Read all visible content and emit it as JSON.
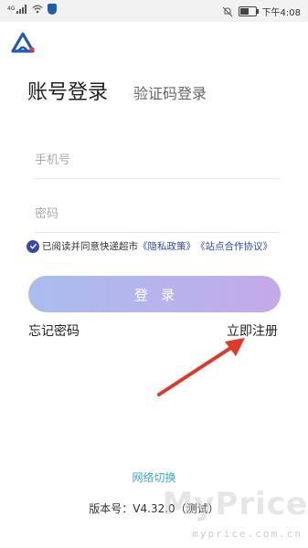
{
  "status_bar": {
    "signal_tag": "4G",
    "time": "下午4:08"
  },
  "login": {
    "tab_account": "账号登录",
    "tab_code": "验证码登录",
    "phone_placeholder": "手机号",
    "password_placeholder": "密码",
    "agree_prefix": "已阅读并同意快递超市",
    "privacy_link": "《隐私政策》",
    "partner_link": "《站点合作协议》",
    "login_button": "登录",
    "forgot_password": "忘记密码",
    "register": "立即注册",
    "network_switch": "网络切换",
    "version": "版本号：V4.32.0（测试）"
  },
  "watermark": {
    "brand": "MyPrice",
    "url": "myprice.com.cn"
  },
  "colors": {
    "accent": "#2b4aa8",
    "annotation_arrow": "#e0392b",
    "network_link": "#3aa6c9"
  },
  "battery_level": 0.6
}
